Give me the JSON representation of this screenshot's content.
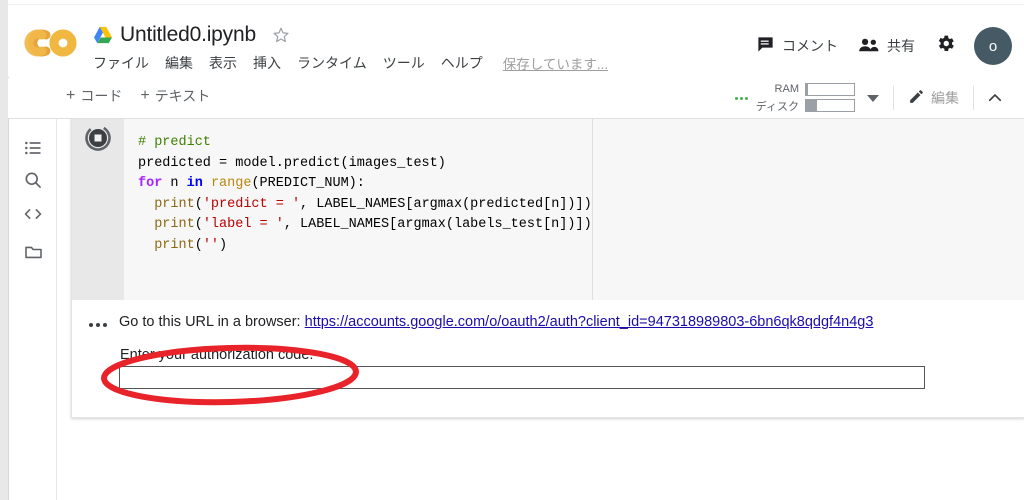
{
  "app": {
    "name": "Google Colaboratory",
    "logo_text": "CO"
  },
  "header": {
    "doc_title": "Untitled0.ipynb",
    "drive_icon": "google-drive-icon",
    "star_icon": "star-outline-icon",
    "menu": [
      "ファイル",
      "編集",
      "表示",
      "挿入",
      "ランタイム",
      "ツール",
      "ヘルプ"
    ],
    "saving_status": "保存しています...",
    "comment_label": "コメント",
    "comment_icon": "comment-icon",
    "share_label": "共有",
    "share_icon": "people-icon",
    "settings_icon": "gear-icon",
    "avatar_initial": "o"
  },
  "toolbar": {
    "add_code_label": "コード",
    "add_text_label": "テキスト",
    "plus_glyph": "+",
    "more_icon": "more-options-icon",
    "ram_label": "RAM",
    "disk_label": "ディスク",
    "ram_fill_percent": 3,
    "disk_fill_percent": 22,
    "caret_icon": "chevron-down-icon",
    "edit_label": "編集",
    "edit_icon": "pencil-icon",
    "collapse_icon": "chevron-up-icon"
  },
  "sidebar": {
    "items": [
      {
        "icon": "table-of-contents-icon",
        "name": "table-of-contents"
      },
      {
        "icon": "search-icon",
        "name": "search"
      },
      {
        "icon": "code-snippets-icon",
        "name": "code-snippets"
      },
      {
        "icon": "folder-icon",
        "name": "files"
      }
    ]
  },
  "cell": {
    "run_state_icon": "stop-execution-icon",
    "code_lines": [
      [
        {
          "t": "# predict",
          "c": "com"
        }
      ],
      [
        {
          "t": "predicted = model.predict(images_test)",
          "c": "txt"
        }
      ],
      [
        {
          "t": "for",
          "c": "kw"
        },
        {
          "t": " n ",
          "c": "txt"
        },
        {
          "t": "in",
          "c": "kw2"
        },
        {
          "t": " ",
          "c": "txt"
        },
        {
          "t": "range",
          "c": "bi"
        },
        {
          "t": "(PREDICT_NUM):",
          "c": "txt"
        }
      ],
      [
        {
          "t": "  ",
          "c": "txt"
        },
        {
          "t": "print",
          "c": "fn"
        },
        {
          "t": "(",
          "c": "txt"
        },
        {
          "t": "'predict = '",
          "c": "str"
        },
        {
          "t": ", LABEL_NAMES[argmax(predicted[n])])",
          "c": "txt"
        }
      ],
      [
        {
          "t": "  ",
          "c": "txt"
        },
        {
          "t": "print",
          "c": "fn"
        },
        {
          "t": "(",
          "c": "txt"
        },
        {
          "t": "'label = '",
          "c": "str"
        },
        {
          "t": ", LABEL_NAMES[argmax(labels_test[n])])",
          "c": "txt"
        }
      ],
      [
        {
          "t": "  ",
          "c": "txt"
        },
        {
          "t": "print",
          "c": "fn"
        },
        {
          "t": "(",
          "c": "txt"
        },
        {
          "t": "''",
          "c": "str"
        },
        {
          "t": ")",
          "c": "txt"
        }
      ]
    ],
    "output": {
      "more_icon": "output-options-icon",
      "message_prefix": "Go to this URL in a browser: ",
      "url": "https://accounts.google.com/o/oauth2/auth?client_id=947318989803-6bn6qk8qdgf4n4g3",
      "prompt_label": "Enter your authorization code:",
      "input_value": "",
      "input_placeholder": ""
    }
  },
  "annotation": {
    "shape": "red-ellipse-highlight",
    "color": "#e8232a",
    "target": "authorization-code-input"
  }
}
